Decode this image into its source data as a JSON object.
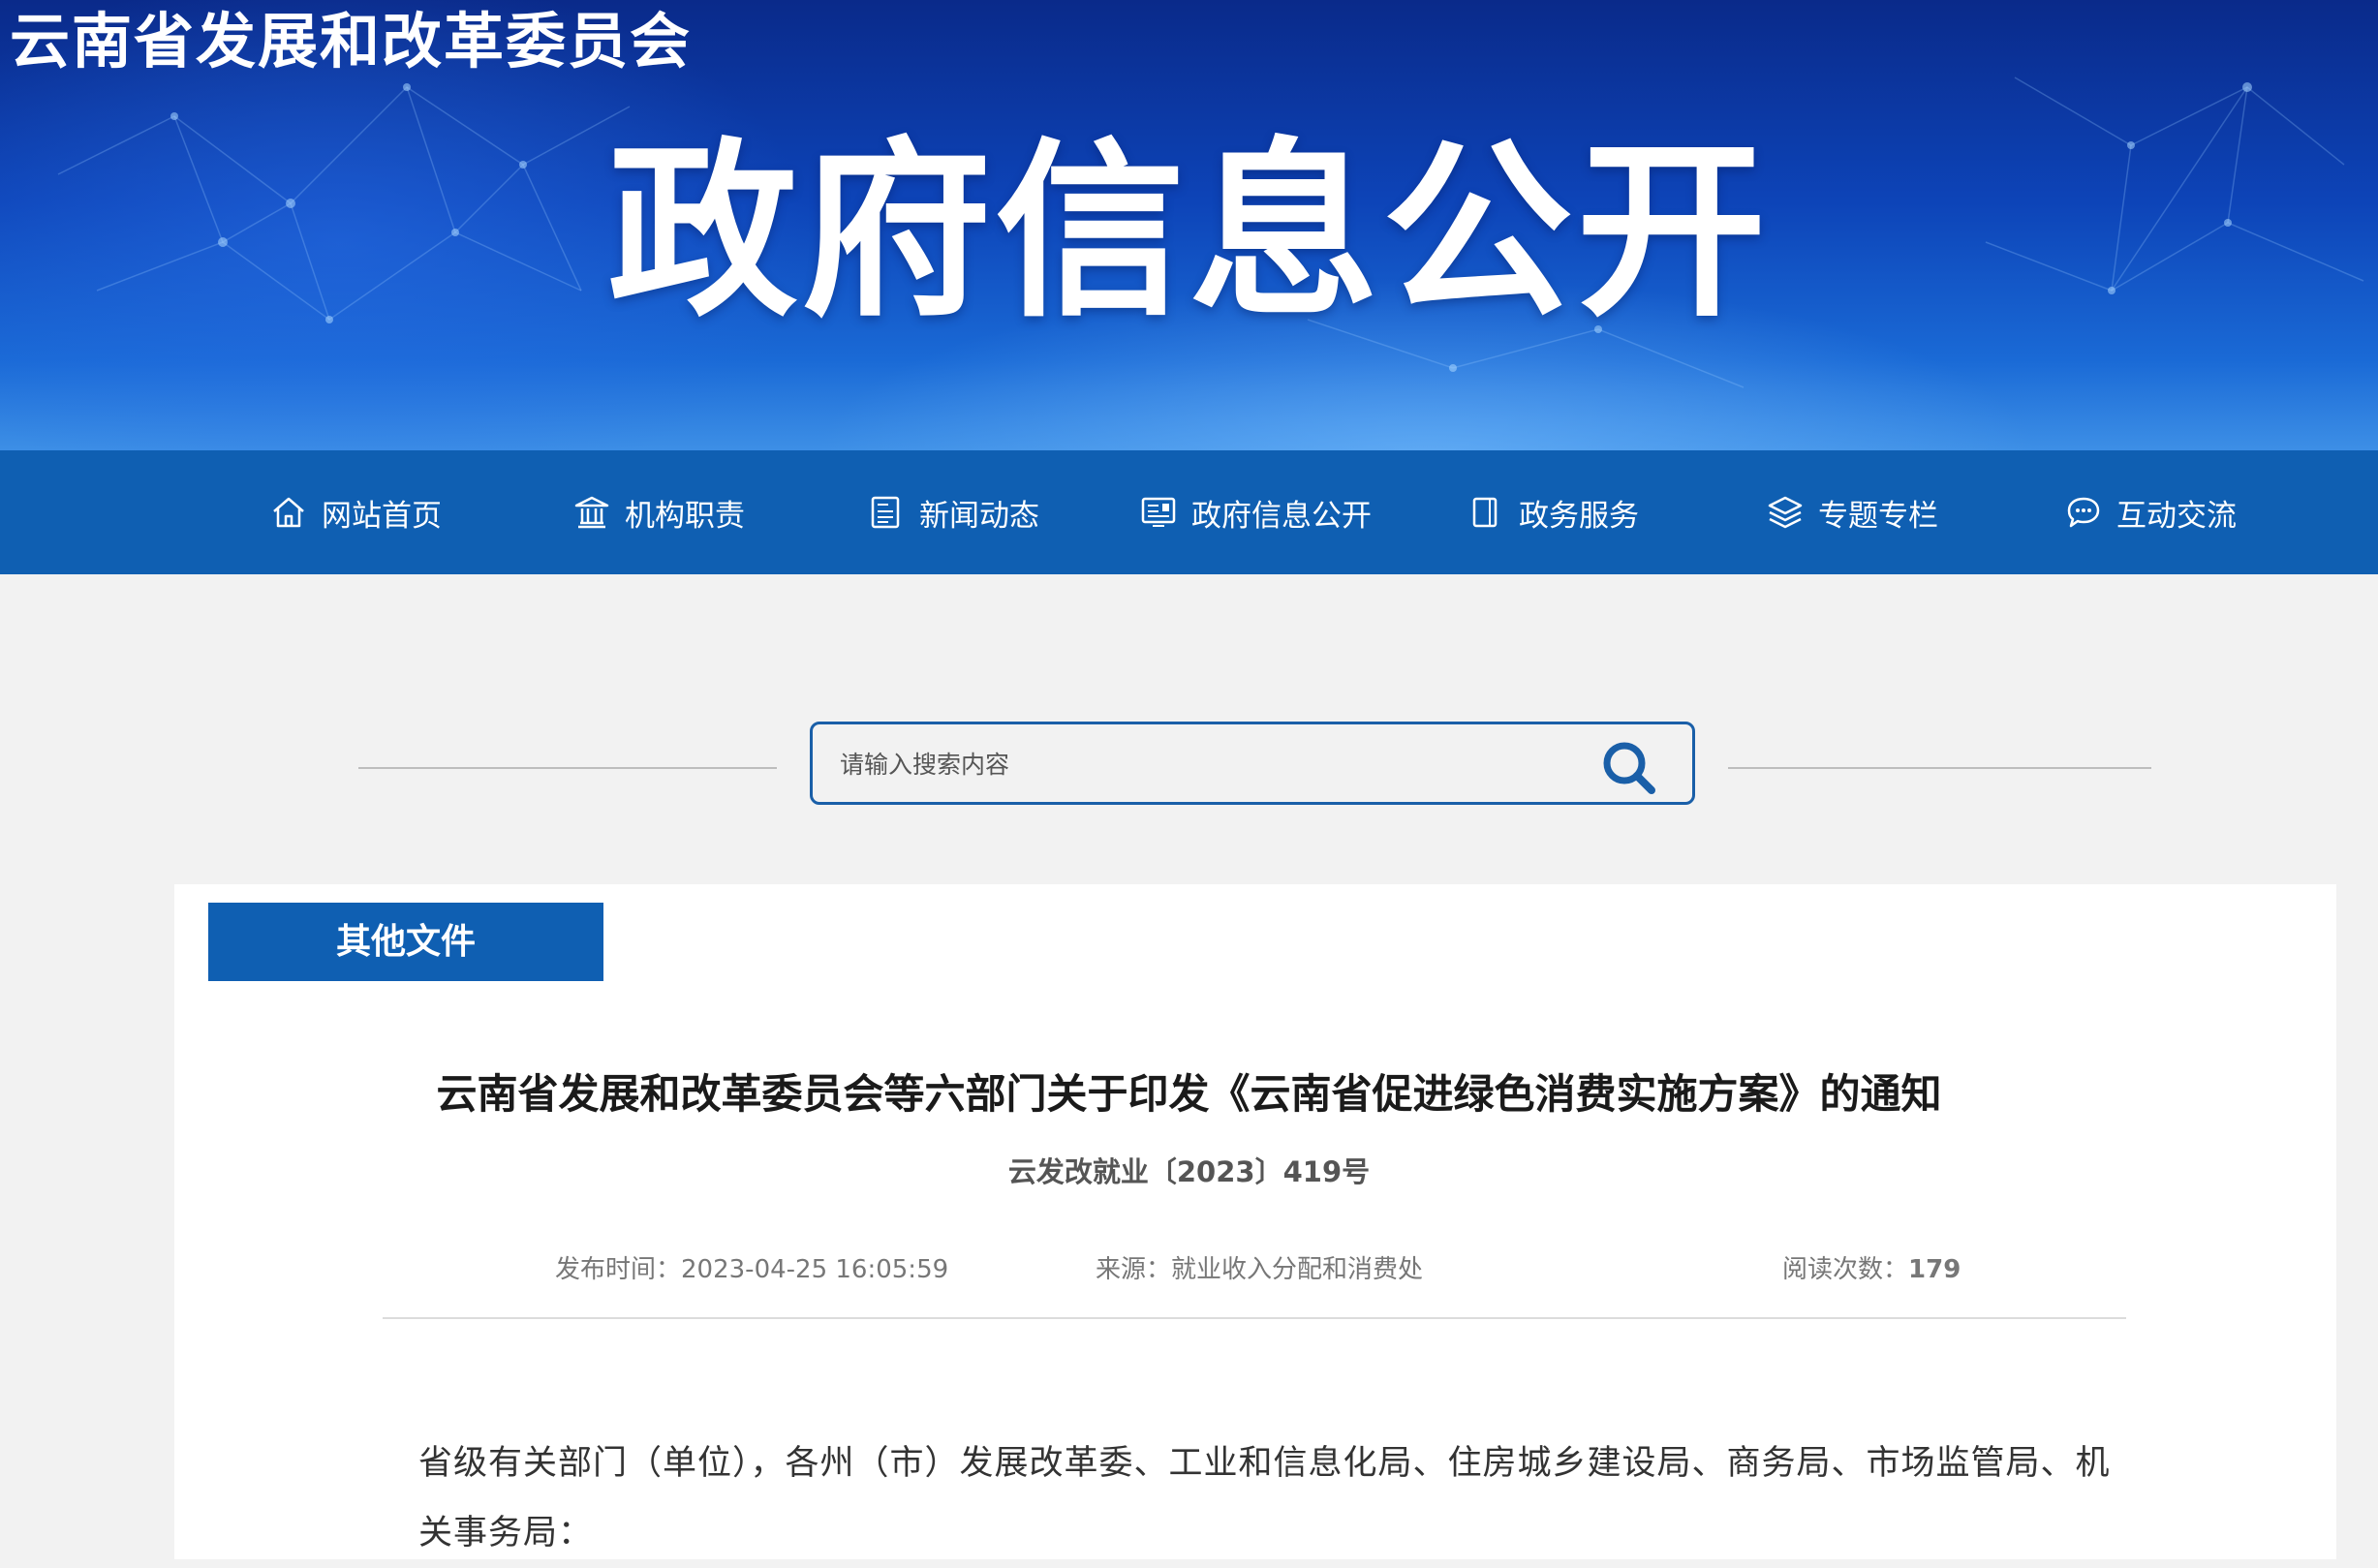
{
  "header": {
    "site_name": "云南省发展和改革委员会",
    "banner_title": "政府信息公开"
  },
  "nav": {
    "items": [
      {
        "label": "网站首页",
        "icon": "home-icon"
      },
      {
        "label": "机构职责",
        "icon": "institution-icon"
      },
      {
        "label": "新闻动态",
        "icon": "news-icon"
      },
      {
        "label": "政府信息公开",
        "icon": "info-board-icon"
      },
      {
        "label": "政务服务",
        "icon": "service-icon"
      },
      {
        "label": "专题专栏",
        "icon": "layers-icon"
      },
      {
        "label": "互动交流",
        "icon": "chat-icon"
      }
    ]
  },
  "search": {
    "placeholder": "请输入搜索内容",
    "icon": "search-icon"
  },
  "category": {
    "label": "其他文件"
  },
  "article": {
    "title": "云南省发展和改革委员会等六部门关于印发《云南省促进绿色消费实施方案》的通知",
    "doc_number": "云发改就业〔2023〕419号",
    "publish_label": "发布时间：",
    "publish_time": "2023-04-25 16:05:59",
    "source_label": "来源：",
    "source": "就业收入分配和消费处",
    "views_label": "阅读次数：",
    "views": "179",
    "body_text": "省级有关部门（单位），各州（市）发展改革委、工业和信息化局、住房城乡建设局、商务局、市场监管局、机关事务局："
  },
  "colors": {
    "nav_bg": "#0f5fb2",
    "accent": "#1a5fa8"
  }
}
